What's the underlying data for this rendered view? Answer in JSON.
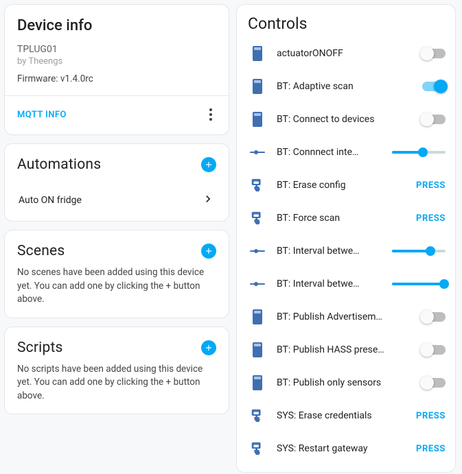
{
  "device": {
    "title": "Device info",
    "name": "TPLUG01",
    "by": "by Theengs",
    "firmware": "Firmware: v1.4.0rc",
    "mqtt_link": "MQTT INFO"
  },
  "automations": {
    "title": "Automations",
    "items": [
      {
        "label": "Auto ON fridge"
      }
    ]
  },
  "scenes": {
    "title": "Scenes",
    "empty": "No scenes have been added using this device yet. You can add one by clicking the + button above."
  },
  "scripts": {
    "title": "Scripts",
    "empty": "No scripts have been added using this device yet. You can add one by clicking the + button above."
  },
  "controls": {
    "title": "Controls",
    "press_label": "PRESS",
    "items": [
      {
        "icon": "device",
        "label": "actuatorONOFF",
        "type": "toggle",
        "on": false
      },
      {
        "icon": "device",
        "label": "BT: Adaptive scan",
        "type": "toggle",
        "on": true
      },
      {
        "icon": "device",
        "label": "BT: Connect to devices",
        "type": "toggle",
        "on": false
      },
      {
        "icon": "slider",
        "label": "BT: Connnect inte…",
        "type": "slider",
        "pos": 0.58
      },
      {
        "icon": "tap",
        "label": "BT: Erase config",
        "type": "press"
      },
      {
        "icon": "tap",
        "label": "BT: Force scan",
        "type": "press"
      },
      {
        "icon": "slider",
        "label": "BT: Interval betwe…",
        "type": "slider",
        "pos": 0.72
      },
      {
        "icon": "slider",
        "label": "BT: Interval betwe…",
        "type": "slider",
        "pos": 0.98
      },
      {
        "icon": "device",
        "label": "BT: Publish Advertisement …",
        "type": "toggle",
        "on": false
      },
      {
        "icon": "device",
        "label": "BT: Publish HASS presence",
        "type": "toggle",
        "on": false
      },
      {
        "icon": "device",
        "label": "BT: Publish only sensors",
        "type": "toggle",
        "on": false
      },
      {
        "icon": "tap",
        "label": "SYS: Erase credentials",
        "type": "press"
      },
      {
        "icon": "tap",
        "label": "SYS: Restart gateway",
        "type": "press"
      }
    ]
  }
}
